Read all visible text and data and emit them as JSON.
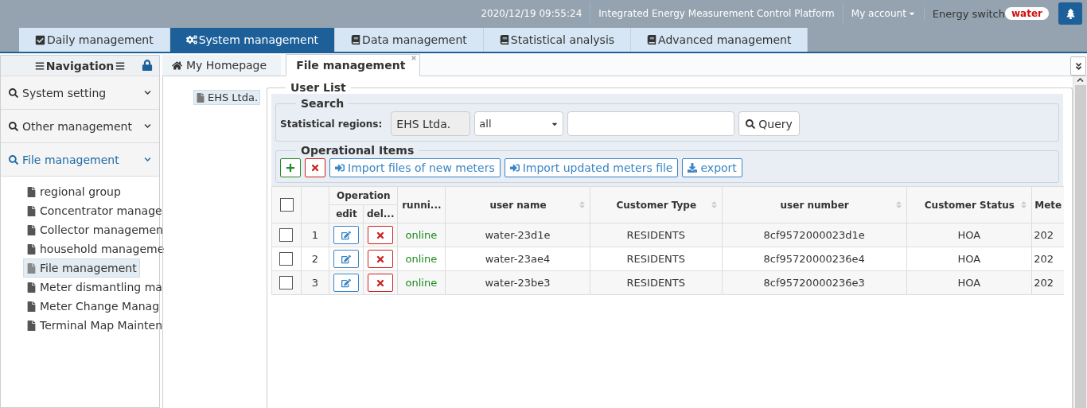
{
  "top_bar": {
    "datetime": "2020/12/19 09:55:24",
    "platform": "Integrated Energy Measurement Control Platform",
    "account": "My account",
    "energy_label": "Energy switch",
    "energy_value": "water"
  },
  "main_tabs": [
    {
      "label": "Daily management",
      "kind": "check",
      "selected": false
    },
    {
      "label": "System management",
      "kind": "cogs",
      "selected": true
    },
    {
      "label": " Data management",
      "kind": "book",
      "selected": false
    },
    {
      "label": "Statistical analysis",
      "kind": "book",
      "selected": false
    },
    {
      "label": " Advanced management",
      "kind": "book",
      "selected": false
    }
  ],
  "sidebar": {
    "title": "Navigation",
    "sections": [
      {
        "label": "System setting",
        "selected": false
      },
      {
        "label": "Other management",
        "selected": false
      },
      {
        "label": "File management",
        "selected": true
      }
    ],
    "items": [
      {
        "label": "regional group",
        "selected": false
      },
      {
        "label": "Concentrator manage",
        "selected": false
      },
      {
        "label": "Collector managemen",
        "selected": false
      },
      {
        "label": "household manageme",
        "selected": false
      },
      {
        "label": "File management",
        "selected": true
      },
      {
        "label": "Meter dismantling ma",
        "selected": false
      },
      {
        "label": "Meter Change Manag",
        "selected": false
      },
      {
        "label": "Terminal Map Mainten",
        "selected": false
      }
    ]
  },
  "page_tabs": [
    {
      "label": "My Homepage",
      "selected": false,
      "closable": false
    },
    {
      "label": "File management",
      "selected": true,
      "closable": true
    }
  ],
  "org_tree": {
    "label": "EHS Ltda."
  },
  "user_list": {
    "title": "User List",
    "search": {
      "title": "Search",
      "region_label": "Statistical regions:",
      "region_value": "EHS Ltda.",
      "filter_value": "all",
      "query_button": "Query"
    },
    "operations": {
      "title": "Operational Items",
      "buttons": [
        {
          "kind": "add"
        },
        {
          "kind": "remove"
        },
        {
          "kind": "import",
          "label": "Import files of new meters"
        },
        {
          "kind": "import",
          "label": "Import updated meters file"
        },
        {
          "kind": "export",
          "label": "export"
        }
      ]
    },
    "table": {
      "header_checked": false,
      "operation_group": "Operation",
      "operation_columns": [
        "edit",
        "del..."
      ],
      "columns": [
        {
          "label": "runni...",
          "sortable": false
        },
        {
          "label": "user name",
          "sortable": true
        },
        {
          "label": "Customer Type",
          "sortable": true
        },
        {
          "label": "user number",
          "sortable": true
        },
        {
          "label": "Customer Status",
          "sortable": true
        },
        {
          "label": "Mete",
          "sortable": false
        }
      ],
      "rows": [
        {
          "checked": false,
          "index": "1",
          "cells": [
            "online",
            "water-23d1e",
            "RESIDENTS",
            "8cf9572000023d1e",
            "HOA",
            "202"
          ]
        },
        {
          "checked": false,
          "index": "2",
          "cells": [
            "online",
            "water-23ae4",
            "RESIDENTS",
            "8cf95720000236e4",
            "HOA",
            "202"
          ]
        },
        {
          "checked": false,
          "index": "3",
          "cells": [
            "online",
            "water-23be3",
            "RESIDENTS",
            "8cf95720000236e3",
            "HOA",
            "202"
          ]
        }
      ]
    }
  }
}
